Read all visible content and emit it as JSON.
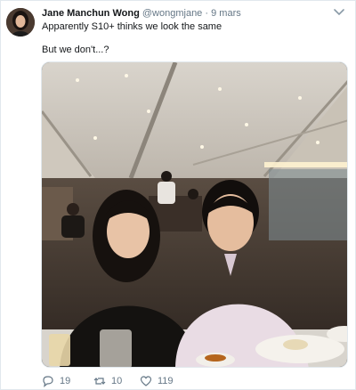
{
  "tweet": {
    "author_name": "Jane Manchun Wong",
    "handle": "@wongmjane",
    "separator": "·",
    "date": "9 mars",
    "line1": "Apparently S10+ thinks we look the same",
    "line2": "But we don't...?",
    "media_icon": "photo",
    "more_icon": "chevron-down-icon",
    "actions": {
      "reply_count": "19",
      "retweet_count": "10",
      "like_count": "119"
    }
  },
  "colors": {
    "muted": "#657786",
    "border": "#e1e8ed",
    "text": "#14171a"
  }
}
